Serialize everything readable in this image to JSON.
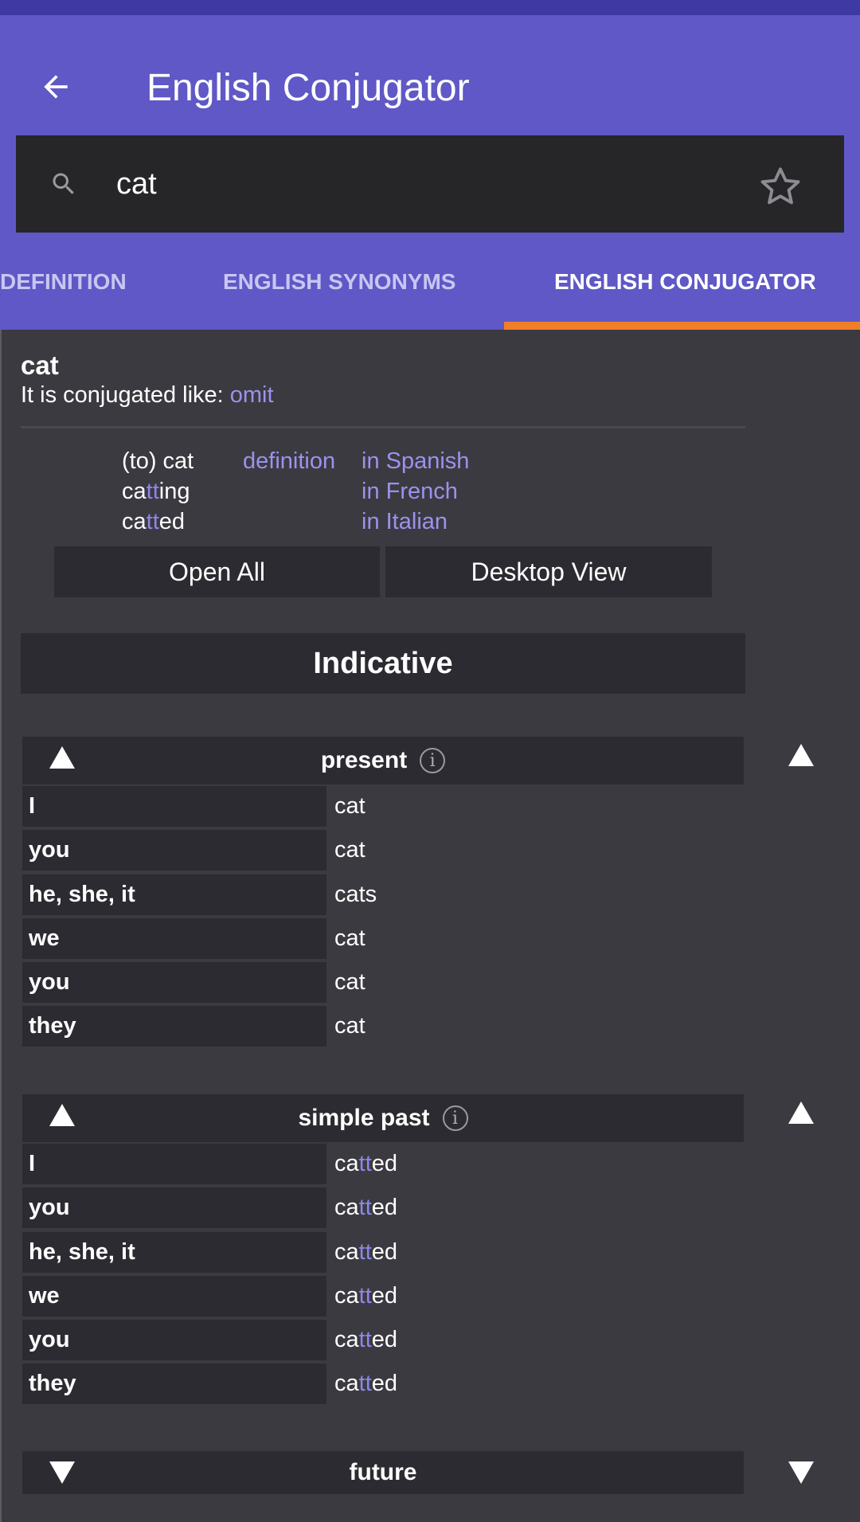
{
  "header": {
    "title": "English Conjugator"
  },
  "search": {
    "value": "cat"
  },
  "tabs": [
    {
      "label": "DEFINITION"
    },
    {
      "label": "ENGLISH SYNONYMS"
    },
    {
      "label": "ENGLISH CONJUGATOR"
    }
  ],
  "colors": {
    "appbar": "#5f58c6",
    "statusbar": "#3f3aa3",
    "tab_indicator": "#f07f2a",
    "link": "#9b92ee",
    "background": "#3b3a40"
  },
  "verb": {
    "word": "cat",
    "conjugated_like_label": "It is conjugated like: ",
    "conjugated_like_verb": "omit",
    "infinitive_prefix": "(to) cat",
    "gerund": {
      "a": "ca",
      "b": "tt",
      "c": "ing"
    },
    "participle": {
      "a": "ca",
      "b": "tt",
      "c": "ed"
    },
    "definition_link": "definition",
    "lang_links": [
      "in Spanish",
      "in French",
      "in Italian"
    ]
  },
  "buttons": {
    "open_all": "Open All",
    "desktop_view": "Desktop View"
  },
  "mood": "Indicative",
  "tenses": [
    {
      "name": "present",
      "rows": [
        {
          "pronoun": "I",
          "a": "cat",
          "b": "",
          "c": ""
        },
        {
          "pronoun": "you",
          "a": "cat",
          "b": "",
          "c": ""
        },
        {
          "pronoun": "he, she, it",
          "a": "cats",
          "b": "",
          "c": ""
        },
        {
          "pronoun": "we",
          "a": "cat",
          "b": "",
          "c": ""
        },
        {
          "pronoun": "you",
          "a": "cat",
          "b": "",
          "c": ""
        },
        {
          "pronoun": "they",
          "a": "cat",
          "b": "",
          "c": ""
        }
      ]
    },
    {
      "name": "simple past",
      "rows": [
        {
          "pronoun": "I",
          "a": "ca",
          "b": "tt",
          "c": "ed"
        },
        {
          "pronoun": "you",
          "a": "ca",
          "b": "tt",
          "c": "ed"
        },
        {
          "pronoun": "he, she, it",
          "a": "ca",
          "b": "tt",
          "c": "ed"
        },
        {
          "pronoun": "we",
          "a": "ca",
          "b": "tt",
          "c": "ed"
        },
        {
          "pronoun": "you",
          "a": "ca",
          "b": "tt",
          "c": "ed"
        },
        {
          "pronoun": "they",
          "a": "ca",
          "b": "tt",
          "c": "ed"
        }
      ]
    },
    {
      "name": "future"
    }
  ],
  "icons": {
    "back": "arrow-back-icon",
    "search": "search-icon",
    "favorite": "star-outline-icon",
    "collapse": "triangle-up-icon",
    "expand": "triangle-down-icon",
    "info": "info-icon"
  }
}
